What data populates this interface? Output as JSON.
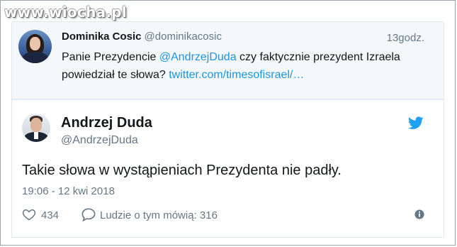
{
  "watermark": {
    "text": "www.wiocha.pl"
  },
  "quoted_tweet": {
    "author_name": "Dominika Cosic",
    "author_handle": "@dominikacosic",
    "time": "13godz.",
    "text_prefix": "Panie Prezydencie ",
    "mention": "@AndrzejDuda",
    "text_middle": " czy faktycznie prezydent Izraela powiedział te słowa? ",
    "link_text": "twitter.com/timesofisrael/…"
  },
  "tweet": {
    "author_name": "Andrzej Duda",
    "author_handle": "@AndrzejDuda",
    "text": "Takie słowa w wystąpieniach Prezydenta nie padły.",
    "date": "19:06 - 12 kwi 2018",
    "likes": "434",
    "replies_label": "Ludzie o tym mówią: 316"
  },
  "colors": {
    "link": "#1b95e0",
    "secondary_text": "#657786",
    "primary_text": "#14171a",
    "quoted_bg": "#f5f8fa",
    "twitter_blue": "#1da1f2"
  },
  "icons": [
    "heart-icon",
    "speech-bubble-icon",
    "twitter-bird-icon",
    "info-icon"
  ]
}
